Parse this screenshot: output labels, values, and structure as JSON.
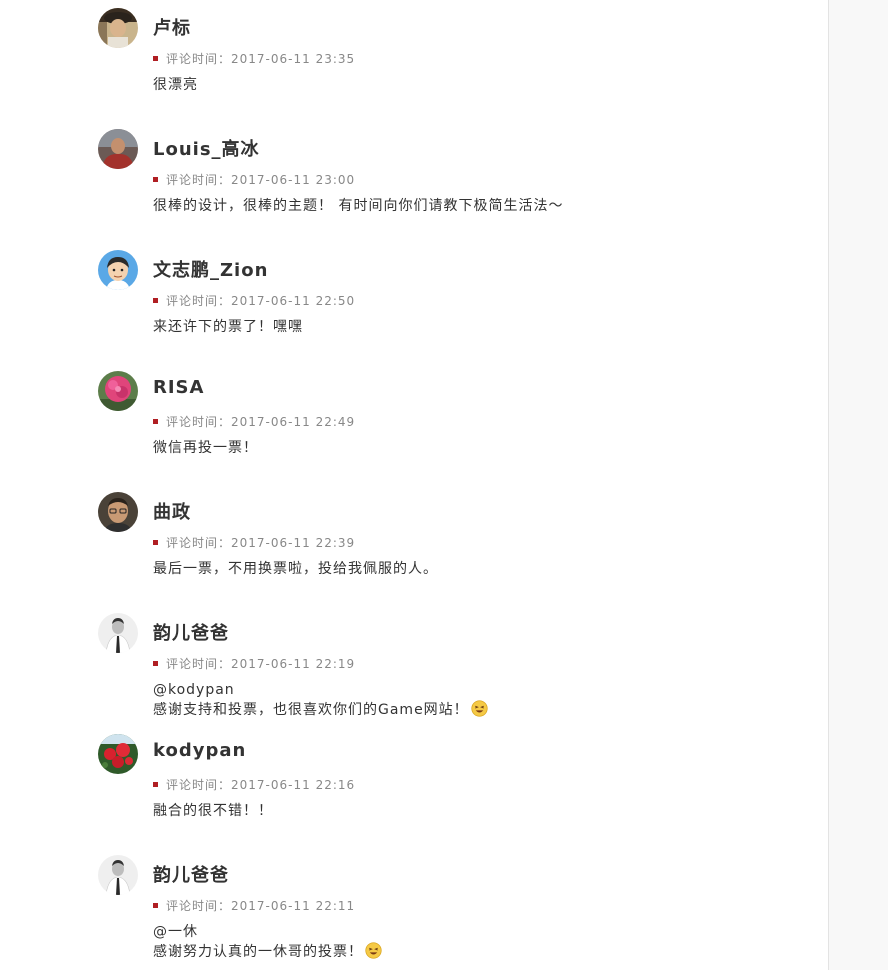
{
  "comments": [
    {
      "name": "卢标",
      "time_label": "评论时间：",
      "time": "2017-06-11 23:35",
      "mention": "",
      "text": "很漂亮",
      "emoji": "",
      "avatar_icon": "avatar-man-hat"
    },
    {
      "name": "Louis_高冰",
      "time_label": "评论时间：",
      "time": "2017-06-11 23:00",
      "mention": "",
      "text": "很棒的设计，很棒的主题！ 有时间向你们请教下极简生活法～",
      "emoji": "",
      "avatar_icon": "avatar-man-red-shirt"
    },
    {
      "name": "文志鹏_Zion",
      "time_label": "评论时间：",
      "time": "2017-06-11 22:50",
      "mention": "",
      "text": "来还许下的票了！嘿嘿",
      "emoji": "",
      "avatar_icon": "avatar-cartoon-face"
    },
    {
      "name": "RISA",
      "time_label": "评论时间：",
      "time": "2017-06-11 22:49",
      "mention": "",
      "text": "微信再投一票！",
      "emoji": "",
      "avatar_icon": "avatar-pink-flower"
    },
    {
      "name": "曲政",
      "time_label": "评论时间：",
      "time": "2017-06-11 22:39",
      "mention": "",
      "text": "最后一票，不用换票啦，投给我佩服的人。",
      "emoji": "",
      "avatar_icon": "avatar-man-glasses"
    },
    {
      "name": "韵儿爸爸",
      "time_label": "评论时间：",
      "time": "2017-06-11 22:19",
      "mention": "@kodypan",
      "text": "感谢支持和投票，也很喜欢你们的Game网站！",
      "emoji": "laughing-emoji",
      "avatar_icon": "avatar-man-bw"
    },
    {
      "name": "kodypan",
      "time_label": "评论时间：",
      "time": "2017-06-11 22:16",
      "mention": "",
      "text": "融合的很不错！！",
      "emoji": "",
      "avatar_icon": "avatar-red-flowers"
    },
    {
      "name": "韵儿爸爸",
      "time_label": "评论时间：",
      "time": "2017-06-11 22:11",
      "mention": "@一休",
      "text": "感谢努力认真的一休哥的投票！",
      "emoji": "laughing-emoji",
      "avatar_icon": "avatar-man-bw"
    }
  ],
  "colors": {
    "accent_square": "#b01e23",
    "name_text": "#333333",
    "meta_text": "#888888",
    "body_text": "#333333",
    "side_panel": "#f8f8f8"
  }
}
